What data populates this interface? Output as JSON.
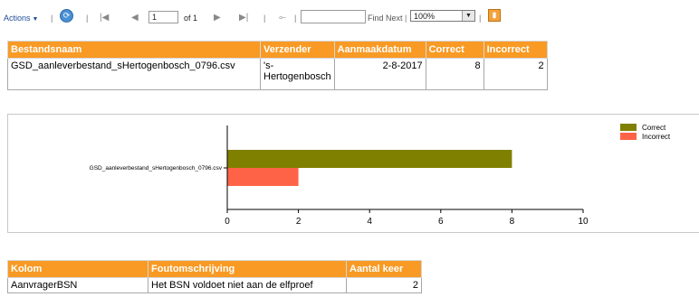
{
  "toolbar": {
    "actions_label": "Actions",
    "page_current": "1",
    "page_of": "of 1",
    "find_value": "",
    "find_next_label": "Find Next",
    "zoom_value": "100%",
    "icons": [
      "chevron-down-icon",
      "refresh-icon",
      "first-page-icon",
      "previous-page-icon",
      "next-page-icon",
      "last-page-icon",
      "document-map-icon",
      "export-icon"
    ]
  },
  "summary_table": {
    "headers": [
      "Bestandsnaam",
      "Verzender",
      "Aanmaakdatum",
      "Correct",
      "Incorrect"
    ],
    "rows": [
      [
        "GSD_aanleverbestand_sHertogenbosch_0796.csv",
        "'s-\nHertogenbosch",
        "2-8-2017",
        "8",
        "2"
      ]
    ]
  },
  "chart_data": {
    "type": "bar",
    "orientation": "horizontal",
    "categories": [
      "GSD_aanleverbestand_sHertogenbosch_0796.csv"
    ],
    "series": [
      {
        "name": "Correct",
        "values": [
          8
        ],
        "color": "#808000"
      },
      {
        "name": "Incorrect",
        "values": [
          2
        ],
        "color": "#ff6347"
      }
    ],
    "xlim": [
      0,
      10
    ],
    "xticks": [
      "0",
      "2",
      "4",
      "6",
      "8",
      "10"
    ],
    "grid": false,
    "legend_position": "top-right"
  },
  "error_table": {
    "headers": [
      "Kolom",
      "Foutomschrijving",
      "Aantal keer"
    ],
    "rows": [
      [
        "AanvragerBSN",
        "Het BSN voldoet niet aan de elfproef",
        "2"
      ]
    ]
  },
  "colors": {
    "header_orange": "#f89a24",
    "correct_bar": "#808000",
    "incorrect_bar": "#ff6347",
    "link_blue": "#1f4e99"
  }
}
